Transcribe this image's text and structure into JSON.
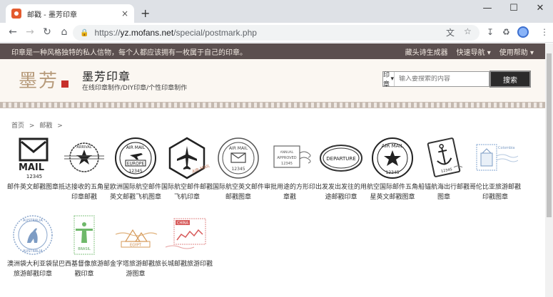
{
  "browser": {
    "tab_title": "邮戳 - 墨芳印章",
    "tab_close": "×",
    "new_tab": "+",
    "url_host": "yz.mofans.net",
    "url_path": "/special/postmark.php",
    "url_scheme": "https://"
  },
  "topbar": {
    "slogan": "印章是一种风格独特的私人信物，每个人都应该拥有一枚属于自己的印章。",
    "links": [
      "藏头诗生成器",
      "快速导航 ▾",
      "使用帮助 ▾"
    ]
  },
  "header": {
    "logo_text": "墨芳",
    "brand_title": "墨芳印章",
    "brand_sub": "在线印章制作/DIY印章/个性印章制作",
    "search_select": "印章",
    "search_placeholder": "输入要搜索的内容",
    "search_button": "搜索"
  },
  "breadcrumb": {
    "home": "首页",
    "sep": ">",
    "current": "邮戳"
  },
  "items": [
    {
      "name": "邮件英文邮戳图章"
    },
    {
      "name": "抵达接收的五角星印章邮戳"
    },
    {
      "name": "欧洲国际航空邮件英文邮戳飞机图章"
    },
    {
      "name": "国际航空邮件邮戳飞机印章"
    },
    {
      "name": "国际航空英文邮件邮戳图章"
    },
    {
      "name": "审批用途的方形印章戳"
    },
    {
      "name": "出发发出发往的用途邮戳印章"
    },
    {
      "name": "航空国际邮件五角星英文邮戳图章"
    },
    {
      "name": "船锚航海出行邮戳图章"
    },
    {
      "name": "哥伦比亚旅游邮戳印戳图章"
    },
    {
      "name": "澳洲袋大利亚袋鼠旅游邮戳印章"
    },
    {
      "name": "巴西基督像旅游邮戳印章"
    },
    {
      "name": "金字塔旅游邮戳旅游图章"
    },
    {
      "name": "长城邮戳旅游印戳"
    }
  ],
  "stamp_text": {
    "mail": "MAIL",
    "num": "12345",
    "arrival": "ARRIVAL",
    "airmail": "AIR MAIL",
    "europe": "EUROPE",
    "approved": "APPROVED",
    "annual": "ANNUAL",
    "departure": "DEPARTURE",
    "colombia": "Colombia",
    "australia": "AUSTRALIA",
    "brasil": "BRASIL",
    "egypt": "EGYPT",
    "china": "CHINA"
  },
  "colors": {
    "topbar": "#5b4f4f",
    "header_bg": "#fbf7f2",
    "accent": "#c7302b"
  }
}
